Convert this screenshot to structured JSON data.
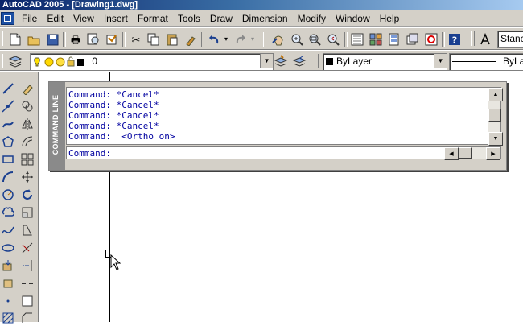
{
  "window": {
    "title": "AutoCAD 2005 - [Drawing1.dwg]"
  },
  "menu": [
    "File",
    "Edit",
    "View",
    "Insert",
    "Format",
    "Tools",
    "Draw",
    "Dimension",
    "Modify",
    "Window",
    "Help"
  ],
  "icons": {
    "standard": [
      "new-icon",
      "open-icon",
      "save-icon",
      "plot-icon",
      "plot-preview-icon",
      "publish-icon",
      "cut-icon",
      "copy-icon",
      "paste-icon",
      "match-properties-icon",
      "undo-icon",
      "redo-icon",
      "pan-icon",
      "zoom-realtime-icon",
      "zoom-window-icon",
      "zoom-previous-icon",
      "properties-icon",
      "design-center-icon",
      "tool-palettes-icon",
      "sheet-set-icon",
      "markup-icon",
      "help-icon",
      "text-style-icon"
    ],
    "left_draw": [
      "line-icon",
      "construction-line-icon",
      "polyline-icon",
      "polygon-icon",
      "rectangle-icon",
      "arc-icon",
      "circle-icon",
      "revision-cloud-icon",
      "spline-icon",
      "ellipse-icon",
      "insert-block-icon",
      "make-block-icon",
      "point-icon",
      "hatch-icon"
    ],
    "left_modify": [
      "erase-icon",
      "copy-object-icon",
      "mirror-icon",
      "offset-icon",
      "array-icon",
      "move-icon",
      "rotate-icon",
      "scale-icon",
      "stretch-icon",
      "trim-icon",
      "extend-icon",
      "break-icon",
      "join-icon",
      "chamfer-icon"
    ]
  },
  "properties_toolbar": {
    "layer_value": "0",
    "color_value": "ByLayer",
    "linetype_value": "ByLa",
    "text_style_value": "Stanc"
  },
  "command_line": {
    "caption": "COMMAND LINE",
    "history": [
      "Command: *Cancel*",
      "Command: *Cancel*",
      "Command: *Cancel*",
      "Command: *Cancel*",
      "Command:  <Ortho on>"
    ],
    "prompt": "Command:"
  }
}
